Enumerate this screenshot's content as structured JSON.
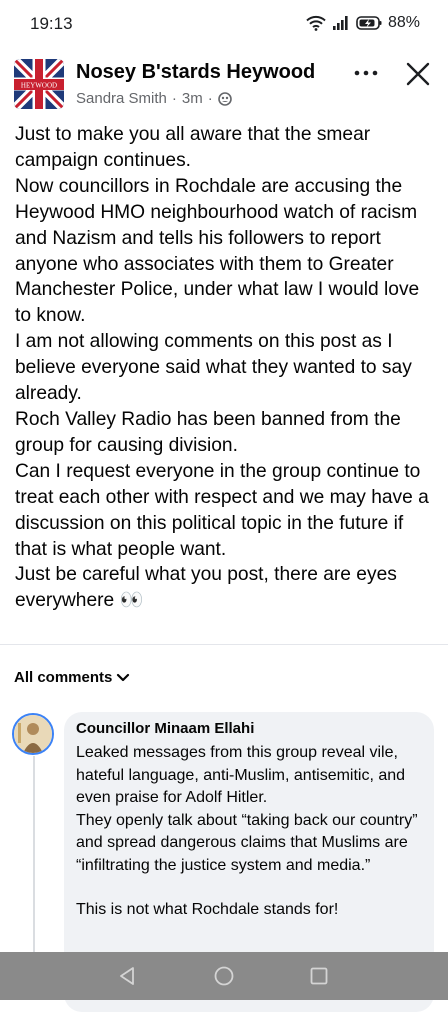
{
  "status": {
    "time": "19:13",
    "battery": "88%",
    "icons": [
      "wifi-icon",
      "signal-icon",
      "battery-icon"
    ]
  },
  "post": {
    "group_name": "Nosey B'stards Heywood",
    "author": "Sandra Smith",
    "separator": "·",
    "time": "3m",
    "audience_icon": "group-audience-icon",
    "logo_text": "HEYWOOD",
    "paragraphs": [
      "Just to make you all aware that the smear campaign continues.",
      "Now councillors in Rochdale are accusing the Heywood HMO neighbourhood watch of racism and Nazism and tells his followers to report anyone who associates with them to Greater Manchester Police, under what law I would love to know.",
      "I am not allowing comments on this post as I believe everyone said what they wanted to say already.",
      "Roch Valley Radio has been banned from the group for causing division.",
      "Can I request everyone in the group continue to treat each other with respect and we may have a discussion on this political topic in the future if that is what people want.",
      "Just be careful what you post,  there are eyes everywhere 👀"
    ]
  },
  "comments_filter": {
    "label": "All comments"
  },
  "comment": {
    "author": "Councillor Minaam Ellahi",
    "paragraphs": [
      "Leaked messages from this group reveal vile, hateful language, anti-Muslim, antisemitic, and even praise for Adolf Hitler.",
      "They openly talk about “taking back our country” and spread dangerous claims that Muslims are “infiltrating the justice system and media.”",
      "This is not what Rochdale stands for!"
    ]
  },
  "nav": {
    "buttons": [
      "back-icon",
      "home-icon",
      "recents-icon"
    ]
  },
  "colors": {
    "text_primary": "#050505",
    "text_secondary": "#65676b",
    "comment_bg": "#f0f2f5",
    "nav_bar": "#8a8a8a",
    "avatar_ring": "#3b82f6"
  }
}
